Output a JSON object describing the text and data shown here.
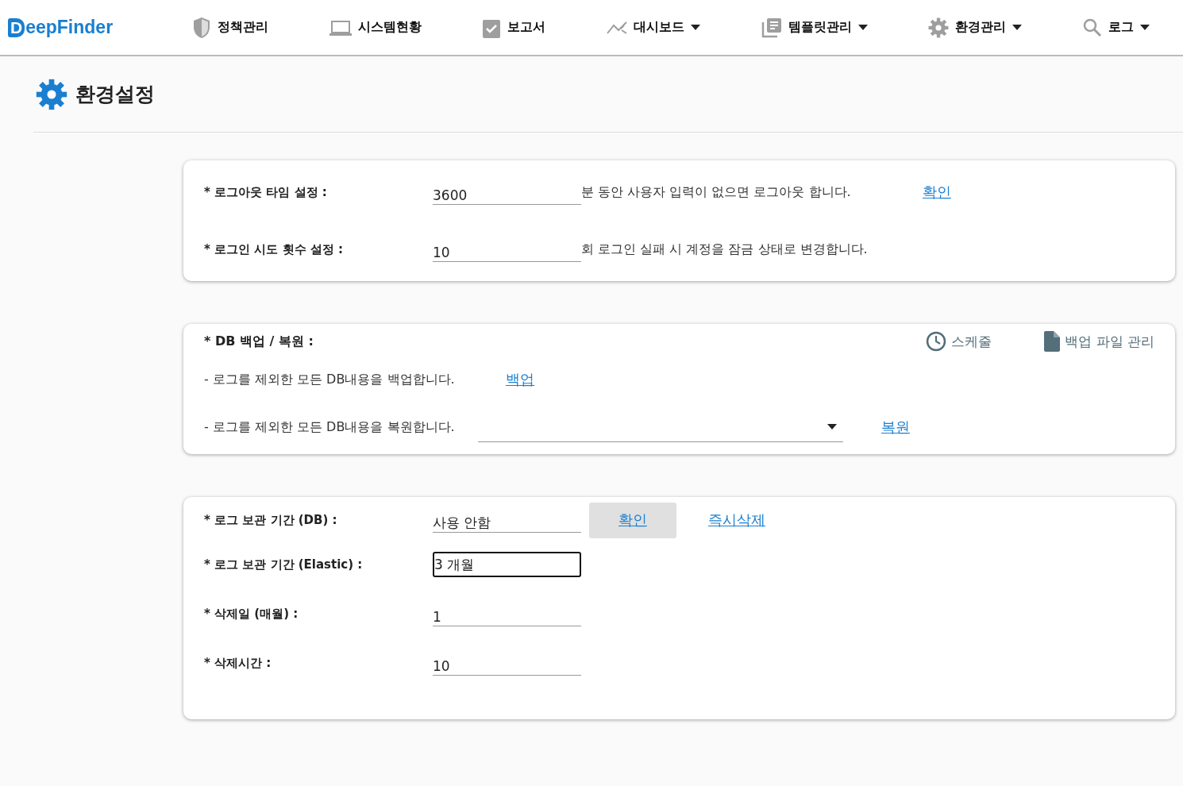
{
  "logo": {
    "text": "eepFinder",
    "initial": "D"
  },
  "nav": [
    {
      "label": "정책관리",
      "dropdown": false
    },
    {
      "label": "시스템현황",
      "dropdown": false
    },
    {
      "label": "보고서",
      "dropdown": false
    },
    {
      "label": "대시보드",
      "dropdown": true
    },
    {
      "label": "템플릿관리",
      "dropdown": true
    },
    {
      "label": "환경관리",
      "dropdown": true
    },
    {
      "label": "로그",
      "dropdown": true
    }
  ],
  "page_title": "환경설정",
  "session_card": {
    "rows": [
      {
        "label": "* 로그아웃 타임 설정 :",
        "value": "3600",
        "hint": "분 동안 사용자 입력이 없으면 로그아웃 합니다.",
        "link": "확인"
      },
      {
        "label": "* 로그인 시도 횟수 설정 :",
        "value": "10",
        "hint": "회 로그인 실패 시 계정을 잠금 상태로 변경합니다."
      }
    ]
  },
  "backup_card": {
    "title": "* DB 백업 / 복원 :",
    "actions": [
      {
        "label": "스케줄"
      },
      {
        "label": "백업 파일 관리"
      }
    ],
    "rows": [
      {
        "kind": "link",
        "text": "- 로그를 제외한 모든 DB내용을 백업합니다.",
        "link": "백업"
      },
      {
        "kind": "select",
        "text": "- 로그를 제외한 모든 DB내용을 복원합니다.",
        "link": "복원"
      }
    ]
  },
  "log_card": {
    "rows": [
      {
        "label": "* 로그 보관 기간 (DB) :",
        "value": "사용 안함",
        "focused": false,
        "button": "확인",
        "link": "즉시삭제"
      },
      {
        "label": "* 로그 보관 기간 (Elastic) :",
        "value": "3 개월",
        "focused": true
      },
      {
        "label": "* 삭제일 (매월) :",
        "value": "1",
        "focused": false
      },
      {
        "label": "* 삭제시간 :",
        "value": "10",
        "focused": false
      }
    ]
  }
}
